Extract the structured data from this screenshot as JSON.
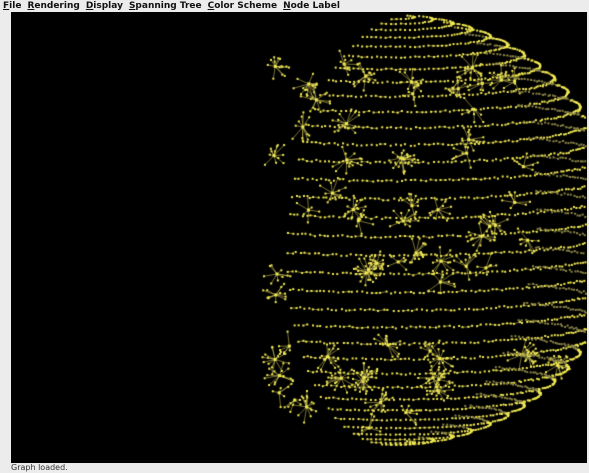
{
  "menu": {
    "items": [
      {
        "label": "File"
      },
      {
        "label": "Rendering"
      },
      {
        "label": "Display"
      },
      {
        "label": "Spanning Tree"
      },
      {
        "label": "Color Scheme"
      },
      {
        "label": "Node Label"
      }
    ]
  },
  "status": {
    "text": "Graph loaded."
  },
  "colors": {
    "background": "#000000",
    "node": "#f2ea52",
    "edge": "#c8c055",
    "node_dim": "#8a8448"
  }
}
